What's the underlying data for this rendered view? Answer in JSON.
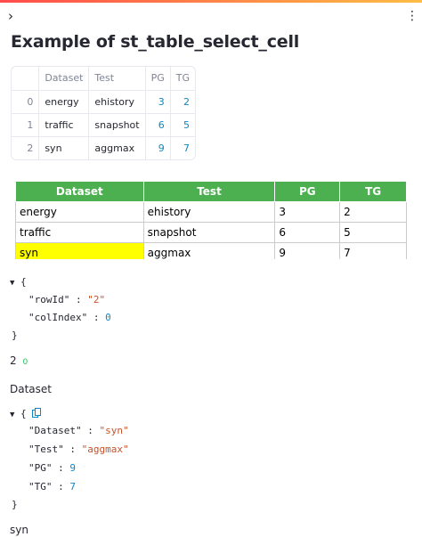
{
  "header": {
    "sidebar_toggle_icon": "chevron-right-icon",
    "sidebar_toggle_glyph": "›",
    "menu_icon": "kebab-menu-icon",
    "menu_glyph": "⋮",
    "gradient_colors": [
      "#ff4b4b",
      "#ffbd45"
    ]
  },
  "title": "Example of st_table_select_cell",
  "dataframe": {
    "columns": [
      "",
      "Dataset",
      "Test",
      "PG",
      "TG"
    ],
    "rows": [
      {
        "index": "0",
        "Dataset": "energy",
        "Test": "ehistory",
        "PG": "3",
        "TG": "2"
      },
      {
        "index": "1",
        "Dataset": "traffic",
        "Test": "snapshot",
        "PG": "6",
        "TG": "5"
      },
      {
        "index": "2",
        "Dataset": "syn",
        "Test": "aggmax",
        "PG": "9",
        "TG": "7"
      }
    ]
  },
  "select_table": {
    "header_color": "#4caf50",
    "selected_color": "#ffff00",
    "columns": [
      "Dataset",
      "Test",
      "PG",
      "TG"
    ],
    "rows": [
      {
        "Dataset": "energy",
        "Test": "ehistory",
        "PG": "3",
        "TG": "2"
      },
      {
        "Dataset": "traffic",
        "Test": "snapshot",
        "PG": "6",
        "TG": "5"
      },
      {
        "Dataset": "syn",
        "Test": "aggmax",
        "PG": "9",
        "TG": "7"
      }
    ]
  },
  "json1": {
    "open": "{",
    "close": "}",
    "row_key": "\"rowId\"",
    "row_val": "\"2\"",
    "col_key": "\"colIndex\"",
    "col_val": "0",
    "sep": " : "
  },
  "text_row_col": {
    "row": "2",
    "col": "0"
  },
  "text_column": "Dataset",
  "json2": {
    "open": "{",
    "close": "}",
    "sep": " : ",
    "k1": "\"Dataset\"",
    "v1": "\"syn\"",
    "k2": "\"Test\"",
    "v2": "\"aggmax\"",
    "k3": "\"PG\"",
    "v3": "9",
    "k4": "\"TG\"",
    "v4": "7"
  },
  "text_value": "syn"
}
